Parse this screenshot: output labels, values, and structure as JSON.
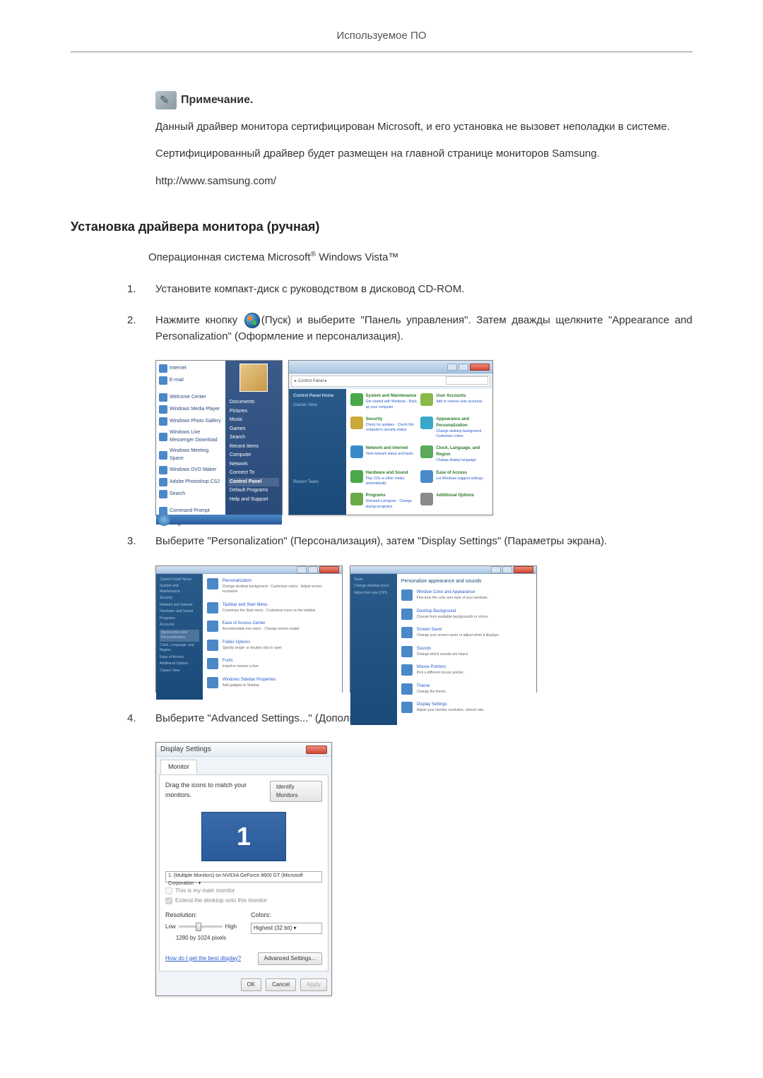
{
  "header": {
    "title": "Используемое ПО"
  },
  "note": {
    "label": "Примечание.",
    "para1": "Данный драйвер монитора сертифицирован Microsoft, и его установка не вызовет неполадки в системе.",
    "para2": "Сертифицированный драйвер будет размещен на главной странице мониторов Samsung.",
    "url": "http://www.samsung.com/"
  },
  "section": {
    "title": "Установка драйвера монитора (ручная)",
    "os_before": "Операционная система Microsoft",
    "os_after": " Windows Vista™",
    "reg": "®"
  },
  "steps": {
    "s1": {
      "num": "1.",
      "text": "Установите компакт-диск с руководством в дисковод CD-ROM."
    },
    "s2": {
      "num": "2.",
      "before": "Нажмите кнопку ",
      "mid": "(Пуск) и выберите \"Панель управления\". Затем дважды щелкните \"Appearance and Personalization\" (Оформление и персонализация)."
    },
    "s3": {
      "num": "3.",
      "text": "Выберите \"Personalization\" (Персонализация), затем \"Display Settings\" (Параметры экрана)."
    },
    "s4": {
      "num": "4.",
      "text": "Выберите \"Advanced Settings...\" (Дополнительные параметры...)."
    }
  },
  "start_menu": {
    "left_items": [
      "Internet",
      "E-mail",
      "Welcome Center",
      "Windows Media Player",
      "Windows Photo Gallery",
      "Windows Live Messenger Download",
      "Windows Meeting Space",
      "Windows DVD Maker",
      "Adobe Photoshop CS2",
      "Search",
      "Command Prompt"
    ],
    "all": "All Programs",
    "right_items": [
      "Documents",
      "Pictures",
      "Music",
      "Games",
      "Search",
      "Recent Items",
      "Computer",
      "Network",
      "Connect To",
      "Control Panel",
      "Default Programs",
      "Help and Support"
    ]
  },
  "control_panel": {
    "nav_path": "▸ Control Panel ▸",
    "side_head": "Control Panel Home",
    "side_item": "Classic View",
    "cats": [
      {
        "h": "System and Maintenance",
        "s": "Get started with Windows · Back up your computer",
        "c": "#4aa84a"
      },
      {
        "h": "User Accounts",
        "s": "Add or remove user accounts",
        "c": "#5aaa5a"
      },
      {
        "h": "Security",
        "s": "Check for updates · Check this computer's security status",
        "c": "#4aa84a"
      },
      {
        "h": "Appearance and Personalization",
        "s": "Change desktop background · Customize colors",
        "c": "#4aa84a"
      },
      {
        "h": "Network and Internet",
        "s": "View network status and tasks",
        "c": "#4aa84a"
      },
      {
        "h": "Clock, Language, and Region",
        "s": "Change display language",
        "c": "#4aa84a"
      },
      {
        "h": "Hardware and Sound",
        "s": "Play CDs or other media automatically",
        "c": "#4aa84a"
      },
      {
        "h": "Ease of Access",
        "s": "Let Windows suggest settings",
        "c": "#4aa84a"
      },
      {
        "h": "Programs",
        "s": "Uninstall a program · Change startup programs",
        "c": "#4aa84a"
      },
      {
        "h": "Additional Options",
        "s": "",
        "c": "#4aa84a"
      }
    ],
    "recent": "Recent Tasks"
  },
  "pers1": {
    "title": "Personalization",
    "side": [
      "Control Panel Home",
      "System and Maintenance",
      "Security",
      "Network and Internet",
      "Hardware and Sound",
      "Programs",
      "Accounts",
      "Appearance and Personalization",
      "Clock, Language, and Region",
      "Ease of Access",
      "Additional Options",
      "Classic View"
    ],
    "items": [
      {
        "t": "Personalization",
        "d": "Change desktop background · Customize colors · Adjust screen resolution"
      },
      {
        "t": "Taskbar and Start Menu",
        "d": "Customize the Start menu · Customize icons on the taskbar"
      },
      {
        "t": "Ease of Access Center",
        "d": "Accommodate low vision · Change screen reader"
      },
      {
        "t": "Folder Options",
        "d": "Specify single- or double-click to open"
      },
      {
        "t": "Fonts",
        "d": "Install or remove a font"
      },
      {
        "t": "Windows Sidebar Properties",
        "d": "Add gadgets to Sidebar"
      }
    ]
  },
  "pers2": {
    "title": "Personalize appearance and sounds",
    "side": [
      "Tasks",
      "Change desktop icons",
      "Adjust font size (DPI)"
    ],
    "items": [
      {
        "t": "Window Color and Appearance",
        "d": "Fine tune the color and style of your windows."
      },
      {
        "t": "Desktop Background",
        "d": "Choose from available backgrounds or colors."
      },
      {
        "t": "Screen Saver",
        "d": "Change your screen saver or adjust when it displays."
      },
      {
        "t": "Sounds",
        "d": "Change which sounds are heard."
      },
      {
        "t": "Mouse Pointers",
        "d": "Pick a different mouse pointer."
      },
      {
        "t": "Theme",
        "d": "Change the theme."
      },
      {
        "t": "Display Settings",
        "d": "Adjust your monitor resolution, refresh rate."
      }
    ]
  },
  "disp": {
    "title": "Display Settings",
    "tab": "Monitor",
    "drag": "Drag the icons to match your monitors.",
    "identify": "Identify Monitors",
    "monitor_num": "1",
    "dropdown": "1. (Multiple Monitors) on NVIDIA GeForce 8600 GT (Microsoft Corporation - ▾",
    "chk1": "This is my main monitor",
    "chk2": "Extend the desktop onto this monitor",
    "res_label": "Resolution:",
    "low": "Low",
    "high": "High",
    "res_text": "1280 by 1024 pixels",
    "colors_label": "Colors:",
    "colors_value": "Highest (32 bit)    ▾",
    "help_link": "How do I get the best display?",
    "adv": "Advanced Settings...",
    "ok": "OK",
    "cancel": "Cancel",
    "apply": "Apply"
  }
}
